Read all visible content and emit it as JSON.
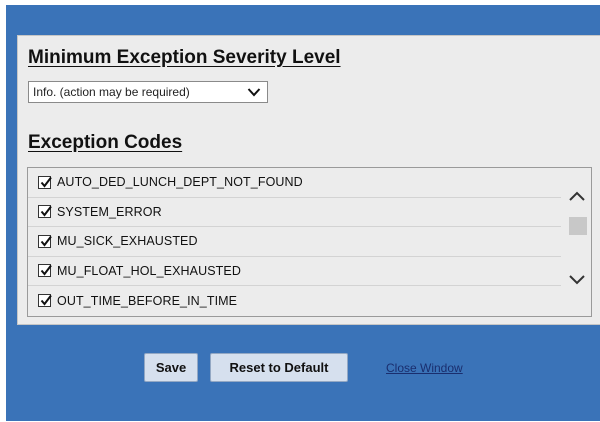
{
  "severity": {
    "heading": "Minimum Exception Severity Level",
    "selected_value": "Info. (action may be required)"
  },
  "codes": {
    "heading": "Exception Codes",
    "items": [
      {
        "label": "AUTO_DED_LUNCH_DEPT_NOT_FOUND",
        "checked": true
      },
      {
        "label": "SYSTEM_ERROR",
        "checked": true
      },
      {
        "label": "MU_SICK_EXHAUSTED",
        "checked": true
      },
      {
        "label": "MU_FLOAT_HOL_EXHAUSTED",
        "checked": true
      },
      {
        "label": "OUT_TIME_BEFORE_IN_TIME",
        "checked": true
      }
    ]
  },
  "actions": {
    "save_label": "Save",
    "reset_label": "Reset to Default",
    "close_label": "Close Window"
  },
  "colors": {
    "frame": "#3a73b8",
    "panel": "#ececec",
    "button": "#d6e0ee",
    "link": "#1a2e6e"
  },
  "icons": {
    "dropdown": "chevron-down-icon",
    "checkbox": "checkmark-icon",
    "scroll_up": "chevron-up-icon",
    "scroll_down": "chevron-down-icon"
  }
}
